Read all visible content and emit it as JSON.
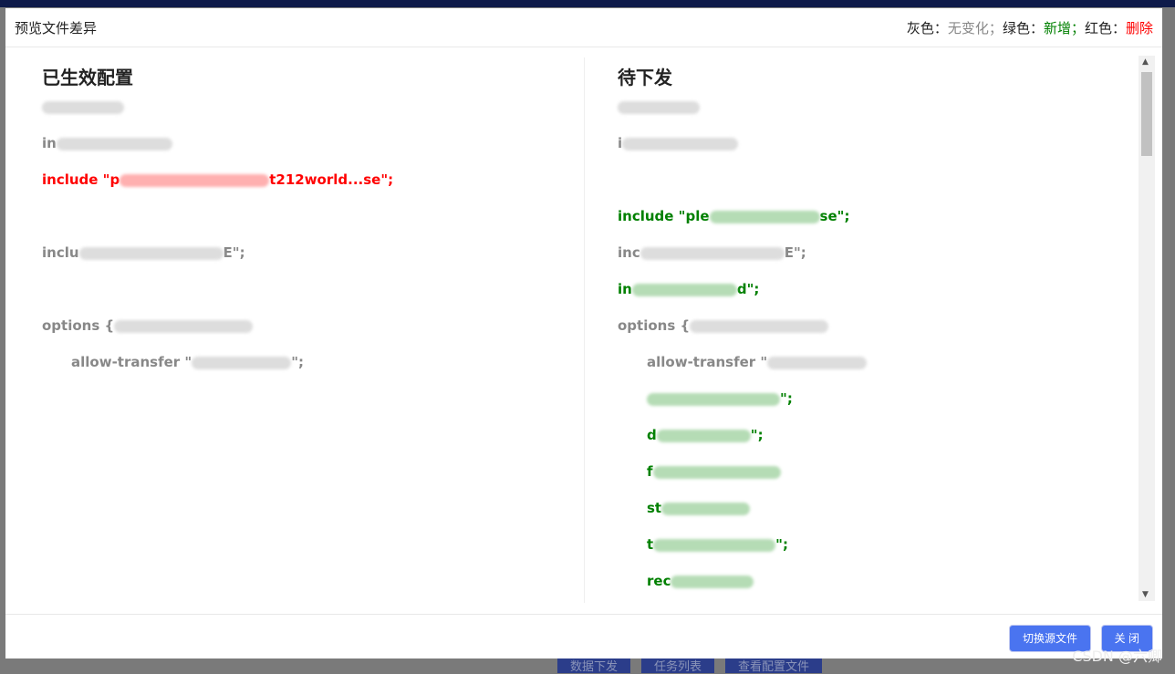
{
  "title": "预览文件差异",
  "legend": {
    "gray_label": "灰色：",
    "gray_value": "无变化；",
    "green_label": "绿色：",
    "green_value": "新增；",
    "red_label": "红色：",
    "red_value": "删除"
  },
  "left": {
    "heading": "已生效配置",
    "lines": [
      {
        "text": "",
        "status": "unchanged"
      },
      {
        "text": "in",
        "status": "unchanged"
      },
      {
        "text": "include \"p",
        "suffix": "t212world...se\";",
        "status": "deleted"
      },
      {
        "text": "",
        "status": "blank"
      },
      {
        "text": "inclu",
        "suffix": "E\";",
        "status": "unchanged"
      },
      {
        "text": "",
        "status": "blank"
      },
      {
        "text": "options {",
        "status": "unchanged"
      },
      {
        "text": "allow-transfer \"",
        "suffix": "\";",
        "status": "unchanged",
        "indent": true
      }
    ]
  },
  "right": {
    "heading": "待下发",
    "lines": [
      {
        "text": "",
        "status": "unchanged"
      },
      {
        "text": "i",
        "status": "unchanged"
      },
      {
        "text": "",
        "status": "blank"
      },
      {
        "text": "include \"ple",
        "suffix": "se\";",
        "status": "added"
      },
      {
        "text": "inc",
        "suffix": "E\";",
        "status": "unchanged"
      },
      {
        "text": "in",
        "suffix": "d\";",
        "status": "added"
      },
      {
        "text": "options {",
        "status": "unchanged"
      },
      {
        "text": "allow-transfer \"",
        "status": "unchanged",
        "indent": true
      },
      {
        "text": "",
        "suffix": "\";",
        "status": "added",
        "indent": true
      },
      {
        "text": "d",
        "suffix": "\";",
        "status": "added",
        "indent": true
      },
      {
        "text": "f",
        "status": "added",
        "indent": true
      },
      {
        "text": "st",
        "status": "added",
        "indent": true
      },
      {
        "text": "t",
        "suffix": "\";",
        "status": "added",
        "indent": true
      },
      {
        "text": "rec",
        "status": "added",
        "indent": true
      }
    ]
  },
  "footer": {
    "switch_label": "切换源文件",
    "close_label": "关 闭"
  },
  "background": {
    "buttons": [
      "数据下发",
      "任务列表",
      "查看配置文件"
    ]
  },
  "watermark": "CSDN @六卿",
  "colors": {
    "unchanged": "#888888",
    "added": "#008000",
    "deleted": "#ff0000",
    "primary": "#4a74f0"
  }
}
